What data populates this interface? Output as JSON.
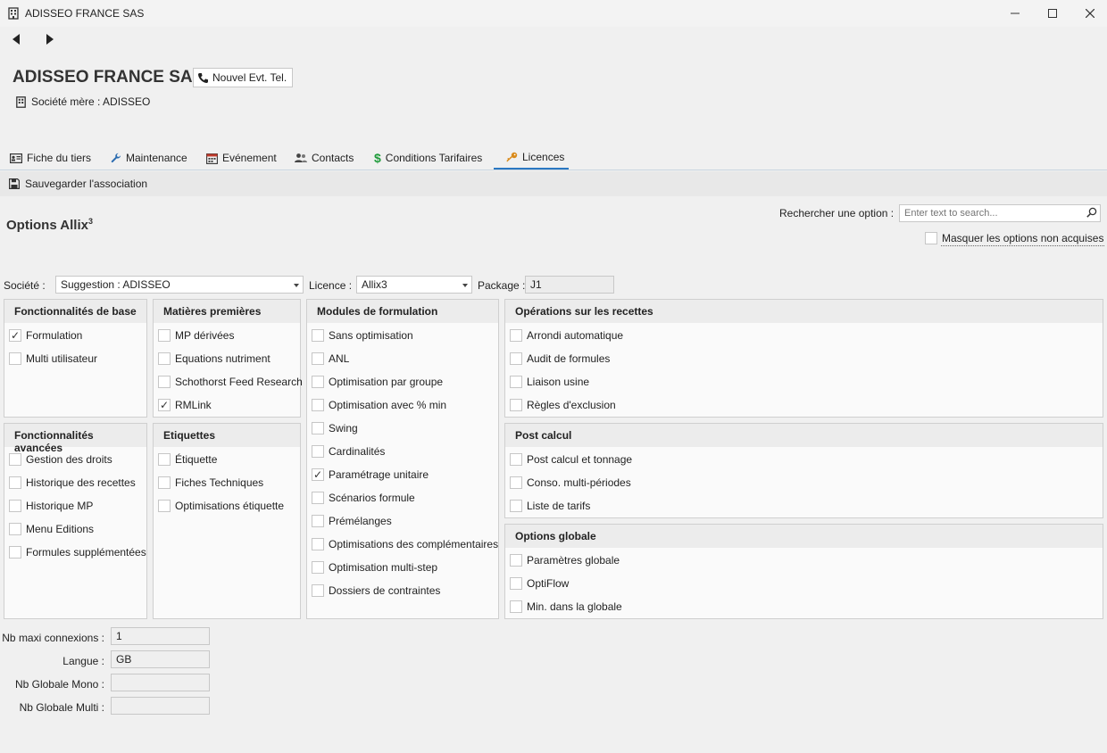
{
  "window": {
    "title": "ADISSEO FRANCE SAS"
  },
  "header": {
    "company": "ADISSEO FRANCE SAS",
    "new_event_label": "Nouvel Evt. Tel.",
    "parent_label": "Société mère : ADISSEO"
  },
  "tabs": [
    {
      "label": "Fiche du tiers",
      "icon": "id-card-icon"
    },
    {
      "label": "Maintenance",
      "icon": "wrench-icon"
    },
    {
      "label": "Evénement",
      "icon": "calendar-icon"
    },
    {
      "label": "Contacts",
      "icon": "contacts-icon"
    },
    {
      "label": "Conditions Tarifaires",
      "icon": "dollar-icon"
    },
    {
      "label": "Licences",
      "icon": "key-icon",
      "active": true
    }
  ],
  "toolbar": {
    "save_label": "Sauvegarder l'association"
  },
  "options": {
    "title": "Options Allix",
    "title_sup": "3",
    "search_label": "Rechercher une option :",
    "search_placeholder": "Enter text to search...",
    "hide_label": "Masquer les options non acquises"
  },
  "form": {
    "societe_label": "Société :",
    "societe_value": "Suggestion : ADISSEO",
    "licence_label": "Licence :",
    "licence_value": "Allix3",
    "package_label": "Package :",
    "package_value": "J1"
  },
  "groups": {
    "base": {
      "title": "Fonctionnalités de base",
      "items": [
        {
          "label": "Formulation",
          "checked": true
        },
        {
          "label": "Multi utilisateur",
          "checked": false
        }
      ]
    },
    "matieres": {
      "title": "Matières premières",
      "items": [
        {
          "label": "MP dérivées",
          "checked": false
        },
        {
          "label": "Equations nutriment",
          "checked": false
        },
        {
          "label": "Schothorst Feed Research",
          "checked": false
        },
        {
          "label": "RMLink",
          "checked": true
        }
      ]
    },
    "modules": {
      "title": "Modules de formulation",
      "items": [
        {
          "label": "Sans optimisation",
          "checked": false
        },
        {
          "label": "ANL",
          "checked": false
        },
        {
          "label": "Optimisation par groupe",
          "checked": false
        },
        {
          "label": "Optimisation avec % min",
          "checked": false
        },
        {
          "label": "Swing",
          "checked": false
        },
        {
          "label": "Cardinalités",
          "checked": false
        },
        {
          "label": "Paramétrage unitaire",
          "checked": true
        },
        {
          "label": "Scénarios formule",
          "checked": false
        },
        {
          "label": "Prémélanges",
          "checked": false
        },
        {
          "label": "Optimisations des complémentaires",
          "checked": false
        },
        {
          "label": "Optimisation multi-step",
          "checked": false
        },
        {
          "label": "Dossiers de contraintes",
          "checked": false
        }
      ]
    },
    "operations": {
      "title": "Opérations sur les recettes",
      "items": [
        {
          "label": "Arrondi automatique",
          "checked": false
        },
        {
          "label": "Audit de formules",
          "checked": false
        },
        {
          "label": "Liaison usine",
          "checked": false
        },
        {
          "label": "Règles d'exclusion",
          "checked": false
        }
      ]
    },
    "avancees": {
      "title": "Fonctionnalités avancées",
      "items": [
        {
          "label": "Gestion des droits",
          "checked": false
        },
        {
          "label": "Historique des recettes",
          "checked": false
        },
        {
          "label": "Historique MP",
          "checked": false
        },
        {
          "label": "Menu Editions",
          "checked": false
        },
        {
          "label": "Formules supplémentées",
          "checked": false
        }
      ]
    },
    "etiquettes": {
      "title": "Etiquettes",
      "items": [
        {
          "label": "Étiquette",
          "checked": false
        },
        {
          "label": "Fiches Techniques",
          "checked": false
        },
        {
          "label": "Optimisations étiquette",
          "checked": false
        }
      ]
    },
    "postcalcul": {
      "title": "Post calcul",
      "items": [
        {
          "label": "Post calcul et tonnage",
          "checked": false
        },
        {
          "label": "Conso. multi-périodes",
          "checked": false
        },
        {
          "label": "Liste de tarifs",
          "checked": false
        }
      ]
    },
    "globale": {
      "title": "Options globale",
      "items": [
        {
          "label": "Paramètres globale",
          "checked": false
        },
        {
          "label": "OptiFlow",
          "checked": false
        },
        {
          "label": "Min. dans la globale",
          "checked": false
        }
      ]
    }
  },
  "bottom_fields": [
    {
      "label": "Nb maxi connexions :",
      "value": "1"
    },
    {
      "label": "Langue :",
      "value": "GB"
    },
    {
      "label": "Nb Globale Mono :",
      "value": ""
    },
    {
      "label": "Nb Globale Multi :",
      "value": ""
    }
  ],
  "colors": {
    "accent": "#2b78c2",
    "dollar": "#1e9b3a",
    "key": "#d98a1a"
  }
}
